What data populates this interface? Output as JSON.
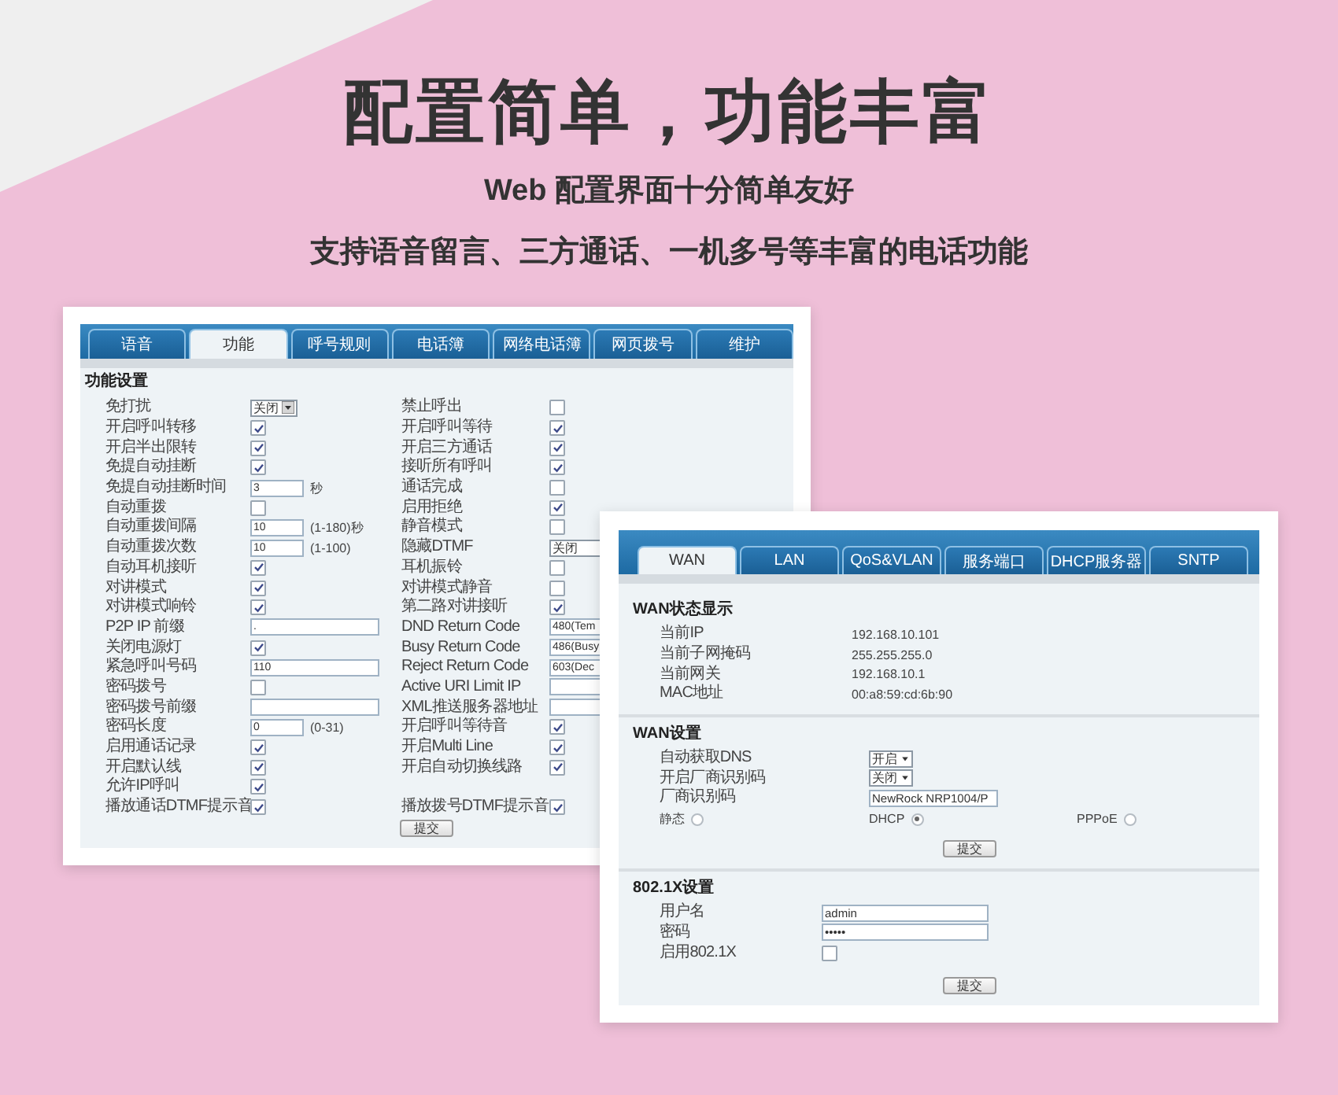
{
  "page": {
    "title": "配置简单，功能丰富",
    "subtitle": "Web 配置界面十分简单友好",
    "tagline": "支持语音留言、三方通话、一机多号等丰富的电话功能"
  },
  "feature_window": {
    "tabs": [
      {
        "label": "语音",
        "selected": false
      },
      {
        "label": "功能",
        "selected": true
      },
      {
        "label": "呼号规则",
        "selected": false
      },
      {
        "label": "电话簿",
        "selected": false
      },
      {
        "label": "网络电话簿",
        "selected": false
      },
      {
        "label": "网页拨号",
        "selected": false
      },
      {
        "label": "维护",
        "selected": false
      }
    ],
    "section_title": "功能设置",
    "rows": [
      {
        "left": {
          "label": "免打扰",
          "kind": "select",
          "value": "关闭"
        },
        "right": {
          "label": "禁止呼出",
          "kind": "checkbox",
          "checked": false
        }
      },
      {
        "left": {
          "label": "开启呼叫转移",
          "kind": "checkbox",
          "checked": true
        },
        "right": {
          "label": "开启呼叫等待",
          "kind": "checkbox",
          "checked": true
        }
      },
      {
        "left": {
          "label": "开启半出限转",
          "kind": "checkbox",
          "checked": true
        },
        "right": {
          "label": "开启三方通话",
          "kind": "checkbox",
          "checked": true
        }
      },
      {
        "left": {
          "label": "免提自动挂断",
          "kind": "checkbox",
          "checked": true
        },
        "right": {
          "label": "接听所有呼叫",
          "kind": "checkbox",
          "checked": true
        }
      },
      {
        "left": {
          "label": "免提自动挂断时间",
          "kind": "number",
          "value": "3",
          "suffix": "秒"
        },
        "right": {
          "label": "通话完成",
          "kind": "checkbox",
          "checked": false
        }
      },
      {
        "left": {
          "label": "自动重拨",
          "kind": "checkbox",
          "checked": false
        },
        "right": {
          "label": "启用拒绝",
          "kind": "checkbox",
          "checked": true
        }
      },
      {
        "left": {
          "label": "自动重拨间隔",
          "kind": "number",
          "value": "10",
          "suffix": "(1-180)秒"
        },
        "right": {
          "label": "静音模式",
          "kind": "checkbox",
          "checked": false
        }
      },
      {
        "left": {
          "label": "自动重拨次数",
          "kind": "number",
          "value": "10",
          "suffix": "(1-100)"
        },
        "right": {
          "label": "隐藏DTMF",
          "kind": "select",
          "value": "关闭"
        }
      },
      {
        "left": {
          "label": "自动耳机接听",
          "kind": "checkbox",
          "checked": true
        },
        "right": {
          "label": "耳机振铃",
          "kind": "checkbox",
          "checked": false
        }
      },
      {
        "left": {
          "label": "对讲模式",
          "kind": "checkbox",
          "checked": true
        },
        "right": {
          "label": "对讲模式静音",
          "kind": "checkbox",
          "checked": false
        }
      },
      {
        "left": {
          "label": "对讲模式响铃",
          "kind": "checkbox",
          "checked": true
        },
        "right": {
          "label": "第二路对讲接听",
          "kind": "checkbox",
          "checked": true
        }
      },
      {
        "left": {
          "label": "P2P IP 前缀",
          "kind": "input",
          "value": "."
        },
        "right": {
          "label": "DND Return Code",
          "kind": "input",
          "value": "480(Tem"
        }
      },
      {
        "left": {
          "label": "关闭电源灯",
          "kind": "checkbox",
          "checked": true
        },
        "right": {
          "label": "Busy Return Code",
          "kind": "input",
          "value": "486(Busy"
        }
      },
      {
        "left": {
          "label": "紧急呼叫号码",
          "kind": "input",
          "value": "110"
        },
        "right": {
          "label": "Reject Return Code",
          "kind": "input",
          "value": "603(Dec"
        }
      },
      {
        "left": {
          "label": "密码拨号",
          "kind": "checkbox",
          "checked": false
        },
        "right": {
          "label": "Active URI Limit IP",
          "kind": "input"
        }
      },
      {
        "left": {
          "label": "密码拨号前缀",
          "kind": "input"
        },
        "right": {
          "label": "XML推送服务器地址",
          "kind": "input"
        }
      },
      {
        "left": {
          "label": "密码长度",
          "kind": "number",
          "value": "0",
          "suffix": "(0-31)"
        },
        "right": {
          "label": "开启呼叫等待音",
          "kind": "checkbox",
          "checked": true
        }
      },
      {
        "left": {
          "label": "启用通话记录",
          "kind": "checkbox",
          "checked": true
        },
        "right": {
          "label": "开启Multi Line",
          "kind": "checkbox",
          "checked": true
        }
      },
      {
        "left": {
          "label": "开启默认线",
          "kind": "checkbox",
          "checked": true
        },
        "right": {
          "label": "开启自动切换线路",
          "kind": "checkbox",
          "checked": true
        }
      },
      {
        "left": {
          "label": "允许IP呼叫",
          "kind": "checkbox",
          "checked": true
        }
      },
      {
        "left": {
          "label": "播放通话DTMF提示音",
          "kind": "checkbox",
          "checked": true
        },
        "right": {
          "label": "播放拨号DTMF提示音",
          "kind": "checkbox",
          "checked": true
        }
      }
    ],
    "submit": "提交"
  },
  "network_window": {
    "tabs": [
      {
        "label": "WAN",
        "selected": true
      },
      {
        "label": "LAN",
        "selected": false
      },
      {
        "label": "QoS&VLAN",
        "selected": false
      },
      {
        "label": "服务端口",
        "selected": false
      },
      {
        "label": "DHCP服务器",
        "selected": false
      },
      {
        "label": "SNTP",
        "selected": false
      }
    ],
    "status": {
      "title": "WAN状态显示",
      "items": [
        {
          "label": "当前IP",
          "value": "192.168.10.101"
        },
        {
          "label": "当前子网掩码",
          "value": "255.255.255.0"
        },
        {
          "label": "当前网关",
          "value": "192.168.10.1"
        },
        {
          "label": "MAC地址",
          "value": "00:a8:59:cd:6b:90"
        }
      ]
    },
    "settings": {
      "title": "WAN设置",
      "fields": [
        {
          "label": "自动获取DNS",
          "kind": "select",
          "value": "开启"
        },
        {
          "label": "开启厂商识别码",
          "kind": "select",
          "value": "关闭"
        },
        {
          "label": "厂商识别码",
          "kind": "input",
          "value": "NewRock NRP1004/P"
        }
      ],
      "modes": [
        {
          "label": "静态",
          "selected": false
        },
        {
          "label": "DHCP",
          "selected": true
        },
        {
          "label": "PPPoE",
          "selected": false
        }
      ],
      "submit": "提交"
    },
    "dot1x": {
      "title": "802.1X设置",
      "fields": [
        {
          "label": "用户名",
          "kind": "input",
          "value": "admin"
        },
        {
          "label": "密码",
          "kind": "input",
          "value": "•••••"
        },
        {
          "label": "启用802.1X",
          "kind": "checkbox",
          "checked": false
        }
      ],
      "submit": "提交"
    }
  }
}
